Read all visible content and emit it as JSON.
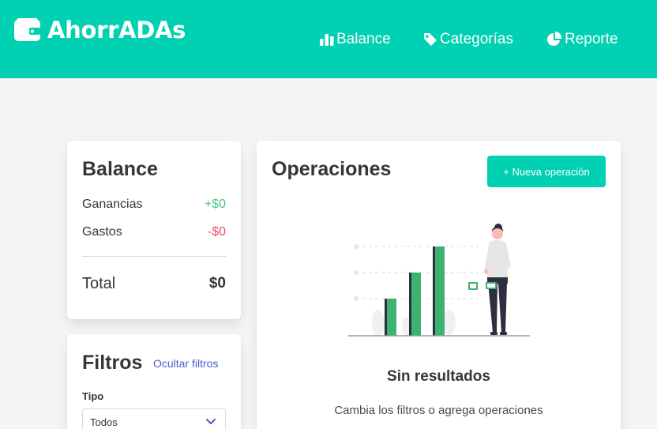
{
  "brand": {
    "title": "AhorrADAs"
  },
  "nav": {
    "items": [
      {
        "label": "Balance",
        "icon": "chart-bar-icon"
      },
      {
        "label": "Categorías",
        "icon": "tag-icon"
      },
      {
        "label": "Reporte",
        "icon": "pie-chart-icon"
      }
    ]
  },
  "balance": {
    "title": "Balance",
    "rows": [
      {
        "label": "Ganancias",
        "value": "+$0"
      },
      {
        "label": "Gastos",
        "value": "-$0"
      }
    ],
    "total": {
      "label": "Total",
      "value": "$0"
    }
  },
  "filters": {
    "title": "Filtros",
    "toggle_label": "Ocultar filtros",
    "type": {
      "label": "Tipo",
      "selected": "Todos"
    }
  },
  "operations": {
    "title": "Operaciones",
    "new_button": "+ Nueva operación",
    "empty": {
      "title": "Sin resultados",
      "subtitle": "Cambia los filtros o agrega operaciones"
    }
  },
  "colors": {
    "primary": "#00d1b2",
    "income": "#48c78e",
    "expense": "#f14668",
    "illustration_green": "#3cb371"
  }
}
